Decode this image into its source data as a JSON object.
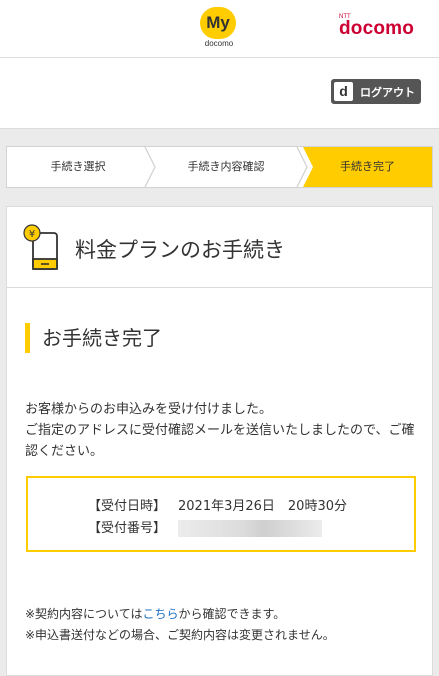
{
  "header": {
    "my_logo_text": "My",
    "my_logo_sub": "docomo",
    "brand_ntt": "NTT",
    "brand_name": "docomo"
  },
  "logout": {
    "d_icon": "d",
    "label": "ログアウト"
  },
  "steps": [
    {
      "label": "手続き選択",
      "active": false
    },
    {
      "label": "手続き内容確認",
      "active": false
    },
    {
      "label": "手続き完了",
      "active": true
    }
  ],
  "card": {
    "title": "料金プランのお手続き",
    "icon": "smartphone-yen-icon",
    "section_title": "お手続き完了",
    "message_line1": "お客様からのお申込みを受け付けました。",
    "message_line2": "ご指定のアドレスに受付確認メールを送信いたしましたので、ご確認ください。",
    "receipt": {
      "datetime_label": "【受付日時】",
      "datetime_value": "2021年3月26日　20時30分",
      "number_label": "【受付番号】"
    },
    "note1_prefix": "※契約内容については",
    "note1_link": "こちら",
    "note1_suffix": "から確認できます。",
    "note2": "※申込書送付などの場合、ご契約内容は変更されません。"
  },
  "colors": {
    "accent": "#ffcc00",
    "brand": "#cc0033",
    "link": "#1a6fc4",
    "logout_bg": "#555555"
  }
}
